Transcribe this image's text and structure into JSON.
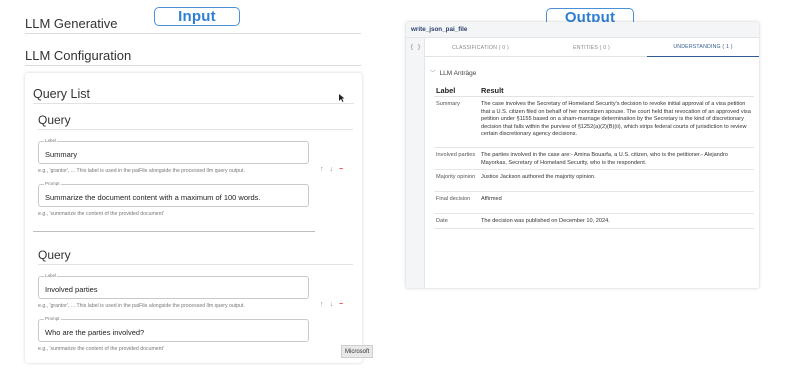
{
  "callouts": {
    "input": "Input",
    "output": "Output"
  },
  "left": {
    "sections": [
      "LLM Generative",
      "LLM Configuration"
    ],
    "query_list_title": "Query List",
    "queries": [
      {
        "title": "Query",
        "label_caption": "Label",
        "label_value": "Summary",
        "label_hint": "e.g., 'grantor', ... This label is used in the paiFile alongside the processed llm query output.",
        "prompt_caption": "Prompt",
        "prompt_value": "Summarize the document content with a maximum of 100 words.",
        "prompt_hint": "e.g., 'summarize the content of the provided document'"
      },
      {
        "title": "Query",
        "label_caption": "Label",
        "label_value": "Involved parties",
        "label_hint": "e.g., 'grantor', ... This label is used in the paiFile alongside the processed llm query output.",
        "prompt_caption": "Prompt",
        "prompt_value": "Who are the parties involved?",
        "prompt_hint": "e.g., 'summarize the content of the provided document'"
      }
    ],
    "actions": {
      "up": "↑",
      "down": "↓",
      "delete": "−"
    },
    "tooltip": "Microsoft"
  },
  "right": {
    "panel_title": "write_json_pai_file",
    "json_icon": "{ }",
    "tabs": [
      "CLASSIFICATION ( 0 )",
      "ENTITIES ( 0 )",
      "UNDERSTANDING ( 1 )"
    ],
    "active_tab": 2,
    "section_label": "LLM Anträge",
    "table_headers": [
      "Label",
      "Result"
    ],
    "rows": [
      {
        "label": "Summary",
        "result": "The case involves the Secretary of Homeland Security's decision to revoke initial approval of a visa petition that a U.S. citizen filed on behalf of her noncitizen spouse. The court held that revocation of an approved visa petition under §1155 based on a sham-marriage determination by the Secretary is the kind of discretionary decision that falls within the purview of §1252(a)(2)(B)(ii), which strips federal courts of jurisdiction to review certain discretionary agency decisions."
      },
      {
        "label": "Involved parties",
        "result": "The parties involved in the case are:- Amina Bouarfa, a U.S. citizen, who is the petitioner.- Alejandro Mayorkas, Secretary of Homeland Security, who is the respondent."
      },
      {
        "label": "Majority opinion",
        "result": "Justice Jackson authored the majority opinion."
      },
      {
        "label": "Final decision",
        "result": "Affirmed"
      },
      {
        "label": "Date",
        "result": "The decision was published on December 10, 2024."
      }
    ]
  },
  "colors": {
    "accent": "#2f7fd4",
    "tab_active": "#2f5d8f",
    "delete": "#dd3333"
  }
}
